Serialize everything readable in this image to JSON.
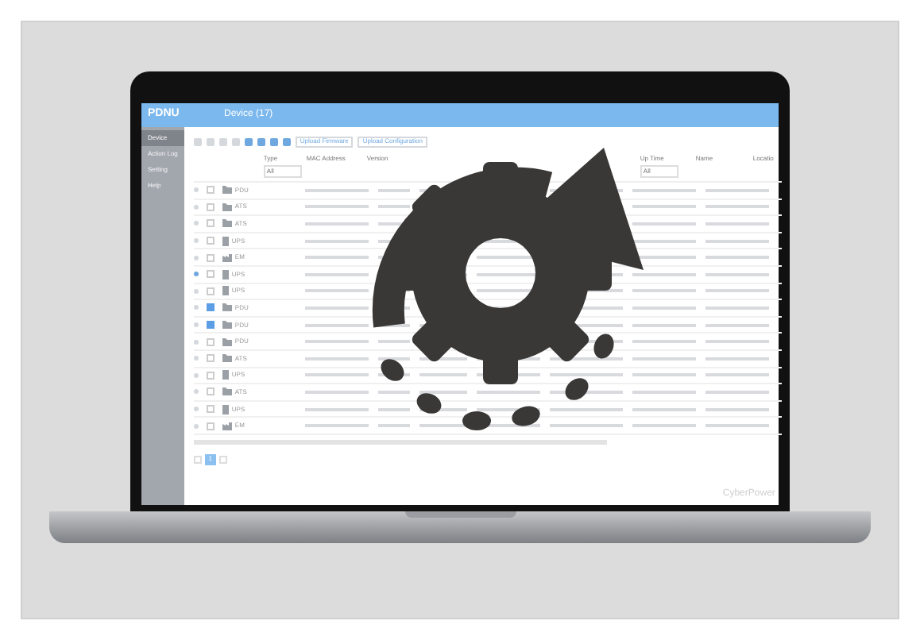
{
  "app": {
    "logo": "PDNU",
    "page_title": "Device (17)"
  },
  "sidebar": {
    "items": [
      {
        "label": "Device",
        "selected": true
      },
      {
        "label": "Action Log",
        "selected": false
      },
      {
        "label": "Setting",
        "selected": false
      },
      {
        "label": "Help",
        "selected": false
      }
    ]
  },
  "toolbar": {
    "buttons": [
      "Upload Firmware",
      "Upload Configuration"
    ]
  },
  "table": {
    "columns": [
      {
        "label": "Type",
        "filter": "All"
      },
      {
        "label": "MAC Address"
      },
      {
        "label": "Version"
      },
      {
        "label": "Up Time",
        "filter": "All"
      },
      {
        "label": "Name"
      },
      {
        "label": "Locatio"
      }
    ],
    "rows": [
      {
        "type": "PDU",
        "checked": false
      },
      {
        "type": "ATS",
        "checked": false
      },
      {
        "type": "ATS",
        "checked": false
      },
      {
        "type": "UPS",
        "checked": false
      },
      {
        "type": "EM",
        "checked": false
      },
      {
        "type": "UPS",
        "checked": false
      },
      {
        "type": "UPS",
        "checked": false
      },
      {
        "type": "PDU",
        "checked": true
      },
      {
        "type": "PDU",
        "checked": true
      },
      {
        "type": "PDU",
        "checked": false
      },
      {
        "type": "ATS",
        "checked": false
      },
      {
        "type": "UPS",
        "checked": false
      },
      {
        "type": "ATS",
        "checked": false
      },
      {
        "type": "UPS",
        "checked": false
      },
      {
        "type": "EM",
        "checked": false
      }
    ]
  },
  "pagination": {
    "current_page": "1"
  },
  "brand": "CyberPower"
}
